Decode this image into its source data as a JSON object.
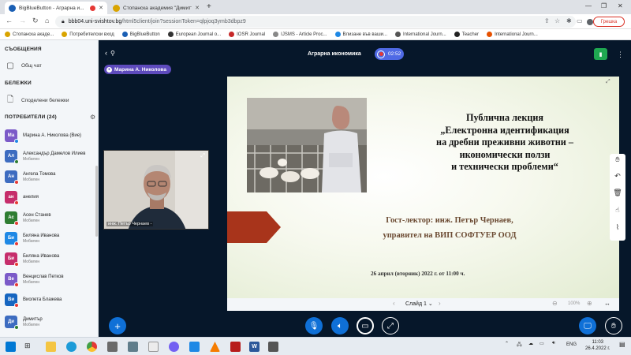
{
  "browser": {
    "tabs": [
      {
        "title": "BigBlueButton - Аграрна и...",
        "active": true
      },
      {
        "title": "Стопанска академия \"Димитър...",
        "active": false
      }
    ],
    "url_host": "bbb04.uni-svishtov.bg",
    "url_path": "/html5client/join?sessionToken=qlpjoq3ymb3dbpz9",
    "error_button": "Грешка",
    "bookmarks": [
      "Стопанска акаде...",
      "Потребителски вход",
      "BigBlueButton",
      "European Journal o...",
      "IOSR Journal",
      "IJSMS - Article Proc...",
      "Влизане във ваши...",
      "International Journ...",
      "Teacher",
      "International Journ..."
    ]
  },
  "sidebar": {
    "messages_header": "СЪОБЩЕНИЯ",
    "public_chat": "Общ чат",
    "notes_header": "БЕЛЕЖКИ",
    "shared_notes": "Споделени бележки",
    "users_header": "ПОТРЕБИТЕЛИ (24)",
    "users": [
      {
        "initials": "Ма",
        "name": "Марина А. Николова (Вие)",
        "sub": "",
        "color": "#7b5ac8"
      },
      {
        "initials": "Ал",
        "name": "Александър Дамелов Илиев",
        "sub": "Мобилен",
        "color": "#3d6cc0"
      },
      {
        "initials": "Ан",
        "name": "Ангела Томова",
        "sub": "Мобилен",
        "color": "#3d6cc0"
      },
      {
        "initials": "ан",
        "name": "анелия",
        "sub": "",
        "color": "#c62d6b"
      },
      {
        "initials": "Ас",
        "name": "Асен Станев",
        "sub": "Мобилен",
        "color": "#2e7d32"
      },
      {
        "initials": "Би",
        "name": "Биляна Иванова",
        "sub": "Мобилен",
        "color": "#1e88e5"
      },
      {
        "initials": "Би",
        "name": "Биляна Иванова",
        "sub": "Мобилен",
        "color": "#c62d6b"
      },
      {
        "initials": "Ве",
        "name": "Венцислав Петков",
        "sub": "Мобилен",
        "color": "#7b5ac8"
      },
      {
        "initials": "Ви",
        "name": "Виолета Блажева",
        "sub": "",
        "color": "#1565c0"
      },
      {
        "initials": "Ди",
        "name": "Димитър",
        "sub": "Мобилен",
        "color": "#3d6cc0"
      }
    ]
  },
  "meeting": {
    "title": "Аграрна икономика",
    "timer": "02:52",
    "presenter": "Марина А. Николова",
    "webcam_name": "инж. Петър Чернаев -"
  },
  "slide": {
    "title_lines": [
      "Публична лекция",
      "„Електронна идентификация",
      "на дребни преживни животни –",
      "икономически ползи",
      "и технически проблеми“"
    ],
    "guest_lines": [
      "Гост-лектор: инж. Петър Чернаев,",
      "управител на ВИП СОФТУЕР ООД"
    ],
    "date": "26 април (вторник) 2022 г. от 11:00 ч.",
    "slide_selector": "Слайд 1",
    "zoom": "100%"
  },
  "taskbar": {
    "lang": "ENG",
    "time": "11:03",
    "date": "26.4.2022 г."
  },
  "colors": {
    "bbb_dark": "#06172a",
    "bbb_blue": "#0f70d7",
    "presenter_purple": "#5e4bbd"
  }
}
